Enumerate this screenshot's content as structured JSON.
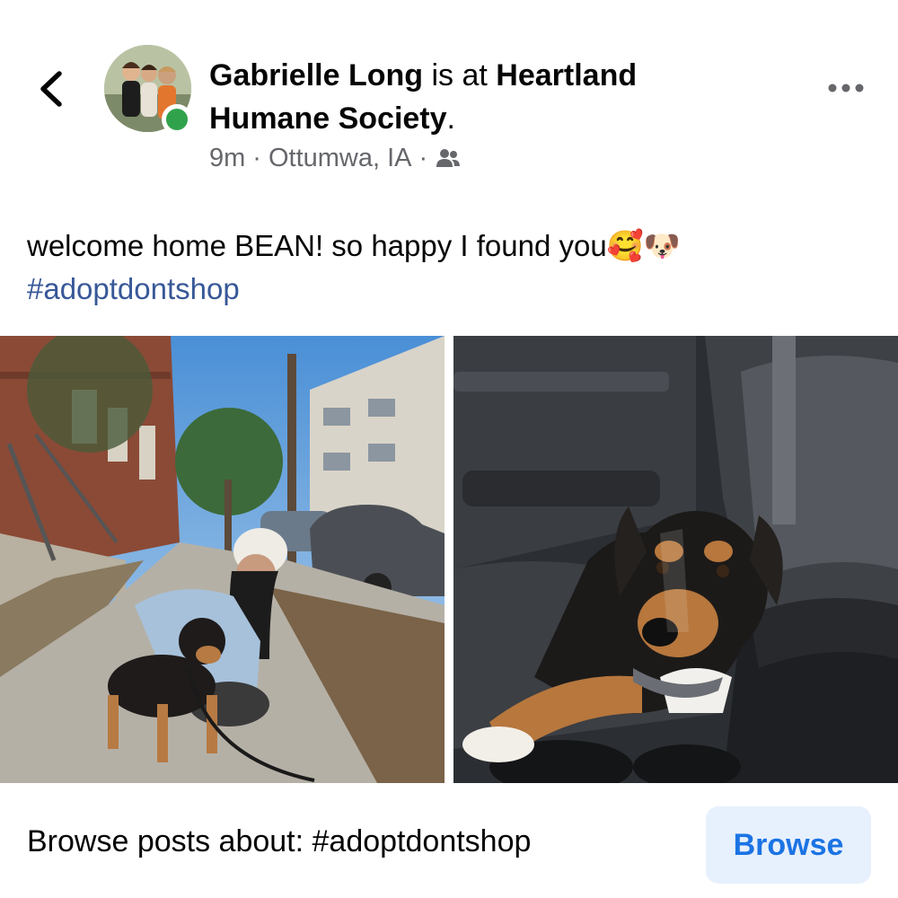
{
  "header": {
    "author": "Gabrielle Long",
    "connector": " is at ",
    "place": "Heartland Humane Society",
    "period": ".",
    "time": "9m",
    "sep1": "·",
    "location": "Ottumwa, IA",
    "sep2": "·",
    "audience_icon": "friends-icon",
    "online": true
  },
  "post": {
    "text": "welcome home BEAN! so happy I found you",
    "emojis": "🥰🐶",
    "hashtag": "#adoptdontshop"
  },
  "photos": [
    {
      "name": "photo-woman-with-dog-on-sidewalk"
    },
    {
      "name": "photo-dog-in-car-seat"
    }
  ],
  "footer": {
    "browse_text": "Browse posts about: #adoptdontshop",
    "browse_button": "Browse"
  },
  "colors": {
    "hashtag": "#385898",
    "online": "#31a24c",
    "button_bg": "#e7f0fd",
    "button_text": "#1b74e4",
    "meta": "#65676b"
  }
}
